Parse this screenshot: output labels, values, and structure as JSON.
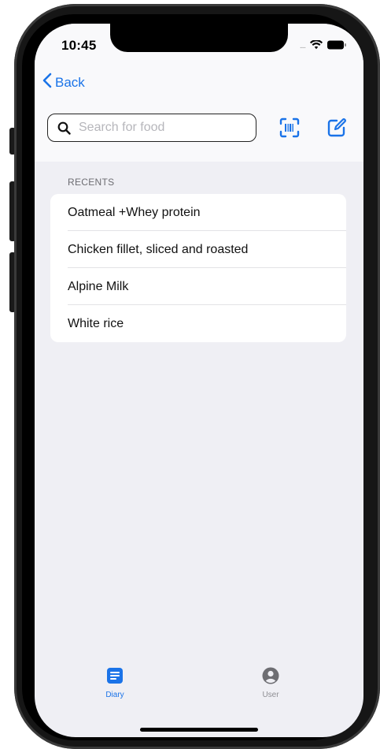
{
  "status_bar": {
    "time": "10:45",
    "signal_dots": "....",
    "wifi_icon": "wifi-icon",
    "battery_icon": "battery-icon"
  },
  "nav": {
    "back_label": "Back",
    "back_icon": "chevron-left-icon"
  },
  "search": {
    "placeholder": "Search for food",
    "value": "",
    "icon": "search-icon"
  },
  "toolbar": {
    "barcode_icon": "barcode-scan-icon",
    "compose_icon": "compose-icon"
  },
  "recents": {
    "title": "RECENTS",
    "items": [
      {
        "label": "Oatmeal +Whey protein"
      },
      {
        "label": "Chicken fillet, sliced and roasted"
      },
      {
        "label": "Alpine Milk"
      },
      {
        "label": "White rice"
      }
    ]
  },
  "tabbar": {
    "tabs": [
      {
        "label": "Diary",
        "icon": "diary-icon",
        "active": true
      },
      {
        "label": "User",
        "icon": "user-icon",
        "active": false
      }
    ]
  },
  "colors": {
    "accent": "#1a73e8",
    "background": "#efeff4",
    "inactive": "#8e8e93"
  }
}
